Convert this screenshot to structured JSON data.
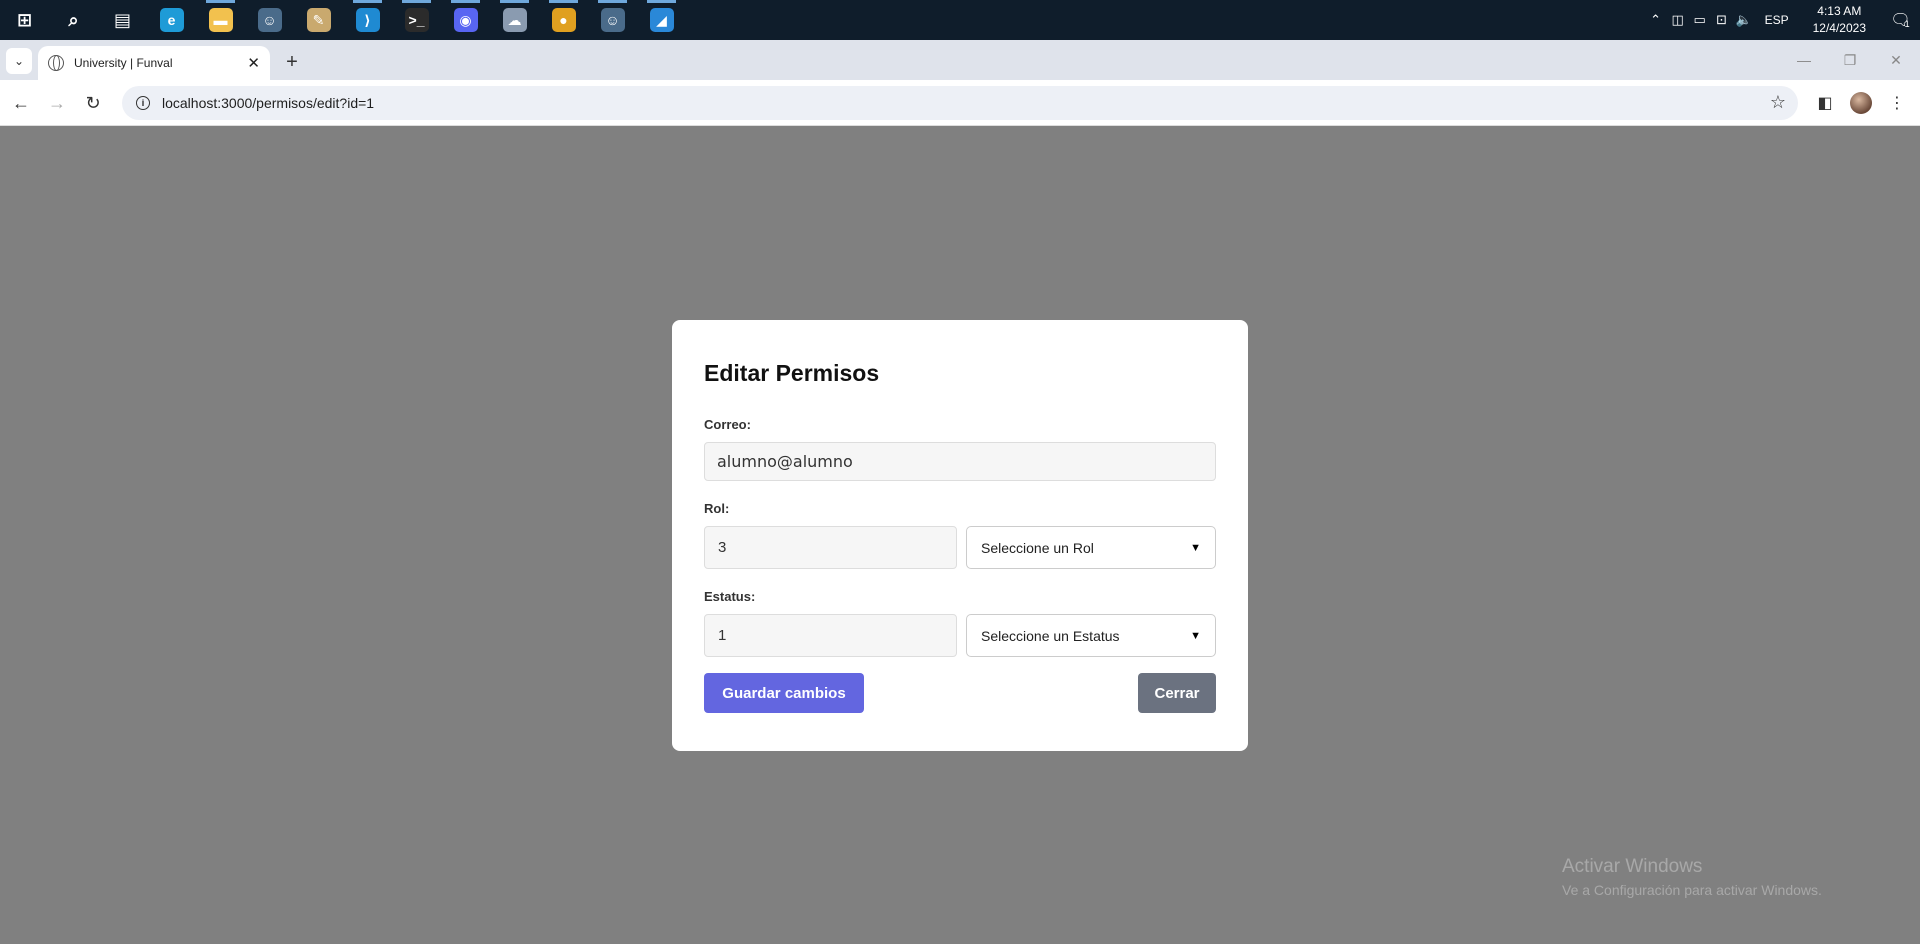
{
  "taskbar": {
    "apps": [
      {
        "name": "windows-start-icon",
        "glyph": "⊞",
        "color": "#ffffff",
        "running": false
      },
      {
        "name": "search-icon",
        "glyph": "⌕",
        "color": "#ffffff",
        "running": false
      },
      {
        "name": "task-view-icon",
        "glyph": "▤",
        "color": "#ffffff",
        "running": false
      },
      {
        "name": "edge-icon",
        "glyph": "e",
        "color": "#1e9bd7",
        "running": false
      },
      {
        "name": "file-explorer-icon",
        "glyph": "▬",
        "color": "#f2c14e",
        "running": true
      },
      {
        "name": "app-icon-1",
        "glyph": "☺",
        "color": "#4a6b8a",
        "running": false
      },
      {
        "name": "paint-icon",
        "glyph": "✎",
        "color": "#c9a96e",
        "running": false
      },
      {
        "name": "vscode-icon",
        "glyph": "⟩",
        "color": "#1f8ad2",
        "running": true
      },
      {
        "name": "terminal-icon",
        "glyph": ">_",
        "color": "#2b2b2b",
        "running": true
      },
      {
        "name": "discord-icon",
        "glyph": "◉",
        "color": "#5865f2",
        "running": true
      },
      {
        "name": "app-icon-2",
        "glyph": "☁",
        "color": "#8a9bb0",
        "running": true
      },
      {
        "name": "chrome-icon",
        "glyph": "●",
        "color": "#e0a020",
        "running": true
      },
      {
        "name": "app-icon-3",
        "glyph": "☺",
        "color": "#4a6b8a",
        "running": true
      },
      {
        "name": "app-icon-4",
        "glyph": "◢",
        "color": "#2a88d8",
        "running": true
      }
    ],
    "lang": "ESP",
    "time": "4:13 AM",
    "date": "12/4/2023",
    "notification_count": "1"
  },
  "browser": {
    "tab_title": "University | Funval",
    "url": "localhost:3000/permisos/edit?id=1"
  },
  "modal": {
    "title": "Editar Permisos",
    "correo_label": "Correo:",
    "correo_value": "alumno@alumno",
    "rol_label": "Rol:",
    "rol_value": "3",
    "rol_select": "Seleccione un Rol",
    "estatus_label": "Estatus:",
    "estatus_value": "1",
    "estatus_select": "Seleccione un Estatus",
    "save_label": "Guardar cambios",
    "close_label": "Cerrar"
  },
  "watermark": {
    "line1": "Activar Windows",
    "line2": "Ve a Configuración para activar Windows."
  }
}
